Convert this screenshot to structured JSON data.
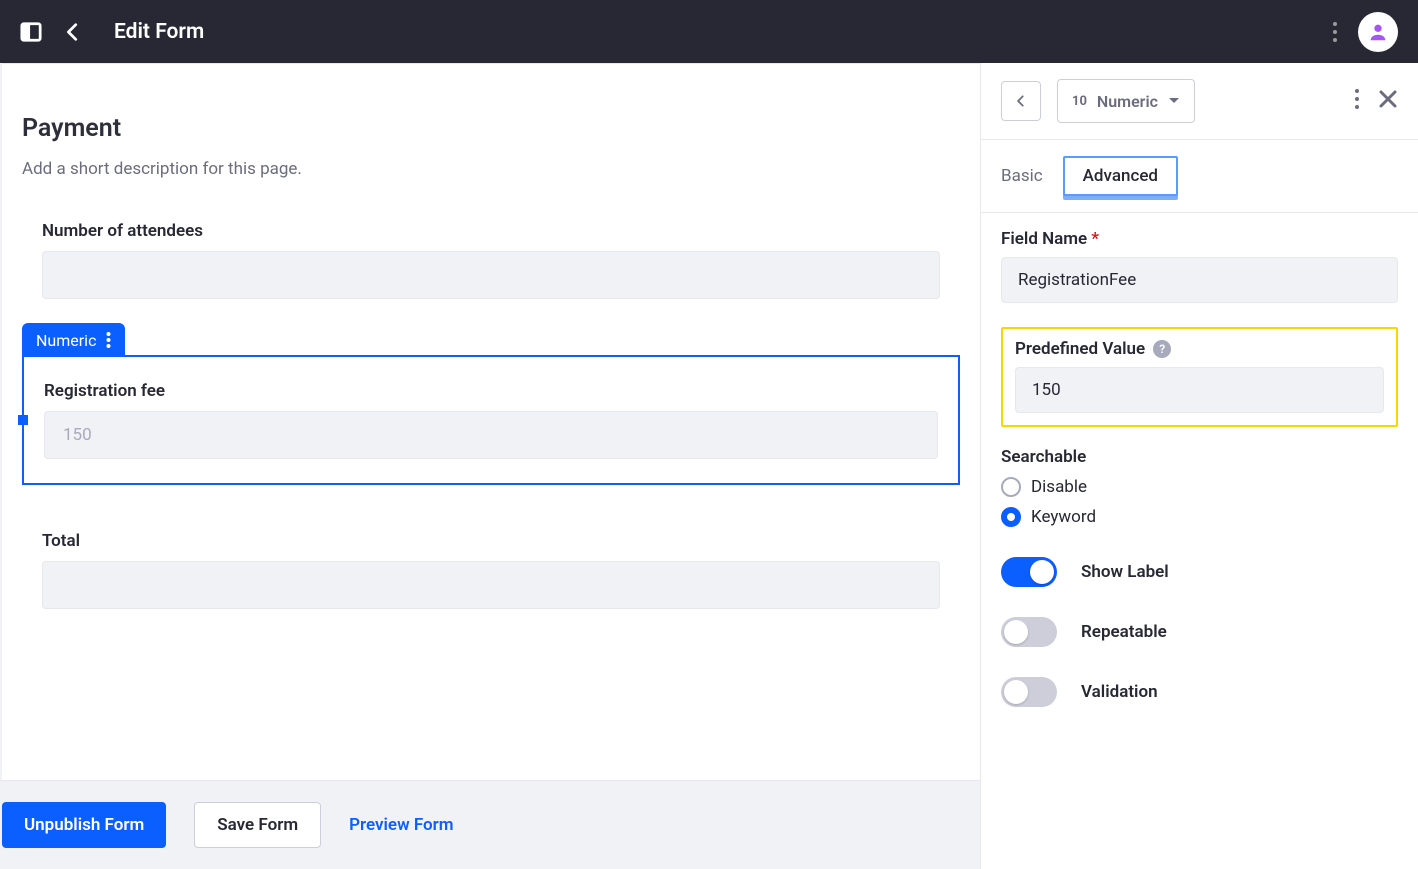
{
  "header": {
    "title": "Edit Form"
  },
  "canvas": {
    "page_heading": "Payment",
    "page_desc_placeholder": "Add a short description for this page.",
    "fields": {
      "attendees": {
        "label": "Number of attendees",
        "value": ""
      },
      "reg_fee": {
        "tag": "Numeric",
        "label": "Registration fee",
        "placeholder": "150"
      },
      "total": {
        "label": "Total",
        "value": ""
      }
    }
  },
  "footer": {
    "unpublish": "Unpublish Form",
    "save": "Save Form",
    "preview": "Preview Form"
  },
  "panel": {
    "type_prefix": "10",
    "type_label": "Numeric",
    "tab_basic": "Basic",
    "tab_advanced": "Advanced",
    "field_name_label": "Field Name",
    "field_name_value": "RegistrationFee",
    "predefined_label": "Predefined Value",
    "predefined_value": "150",
    "searchable_label": "Searchable",
    "searchable_disable": "Disable",
    "searchable_keyword": "Keyword",
    "show_label": "Show Label",
    "repeatable": "Repeatable",
    "validation": "Validation"
  }
}
